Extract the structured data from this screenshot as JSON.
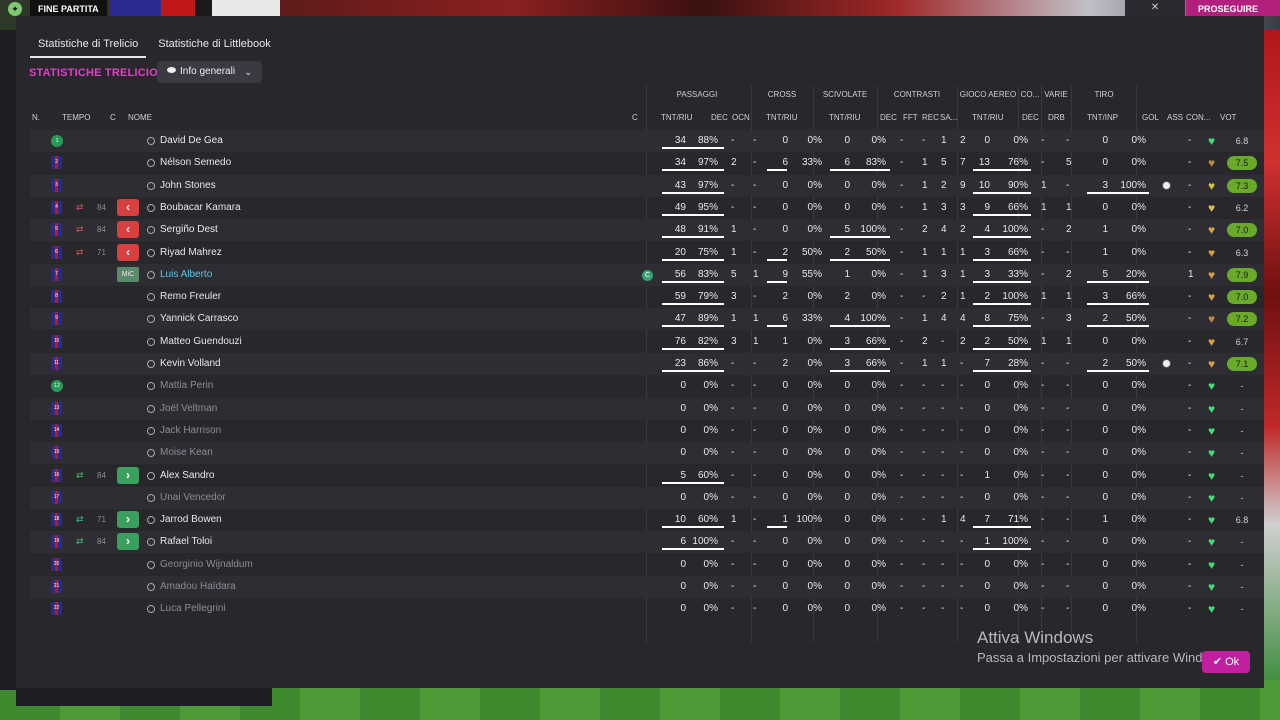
{
  "topbar": {
    "match_label": "FINE PARTITA",
    "continue_label": "PROSEGUIRE"
  },
  "tabs": [
    {
      "label": "Statistiche di Trelicio",
      "active": true
    },
    {
      "label": "Statistiche di Littlebook",
      "active": false
    }
  ],
  "section_title": "STATISTICHE TRELICIO",
  "dropdown": {
    "label": "Info generali"
  },
  "header_groups": {
    "passaggi": "PASSAGGI",
    "cross": "CROSS",
    "scivolate": "SCIVOLATE",
    "contrasti": "CONTRASTI",
    "gioco_aereo": "GIOCO AEREO",
    "co": "CO...",
    "varie": "VARIE",
    "tiro": "TIRO"
  },
  "header_cols": {
    "n": "N.",
    "tempo": "TEMPO",
    "c": "C",
    "nome": "NOME",
    "c2": "C",
    "pass_tnt": "TNT/RIU",
    "dec": "DEC",
    "ocn": "OCN",
    "cross_tnt": "TNT/RIU",
    "sciv_tnt": "TNT/RIU",
    "con_dec": "DEC",
    "fft": "FFT",
    "rec": "REC",
    "sa": "SA...",
    "aereo_tnt": "TNT/RIU",
    "co_dec": "DEC",
    "drb": "DRB",
    "tiro_tnt": "TNT/INP",
    "gol": "GOL",
    "ass": "ASS",
    "con": "CON...",
    "vot": "VOT"
  },
  "players": [
    {
      "n": "1",
      "gk": true,
      "name": "David De Gea",
      "sub": "",
      "min": "",
      "pos": "",
      "cap": false,
      "pass": [
        "34",
        "88%"
      ],
      "dec": "-",
      "ocn": "-",
      "cross": [
        "0",
        "0%"
      ],
      "sciv": [
        "0",
        "0%"
      ],
      "con": [
        "-",
        "-",
        "1",
        "2"
      ],
      "aereo": [
        "0",
        "0%"
      ],
      "codec": "-",
      "drb": "-",
      "tiro": [
        "0",
        "0%"
      ],
      "gol": "",
      "ass": "-",
      "heart": "#40e070",
      "vot": "6.8",
      "vgreen": false,
      "ul": {
        "pass": true,
        "cross": false,
        "sciv": false,
        "aereo": false,
        "tiro": false
      }
    },
    {
      "n": "2",
      "gk": false,
      "name": "Nélson Semedo",
      "sub": "",
      "min": "",
      "pos": "",
      "cap": false,
      "pass": [
        "34",
        "97%"
      ],
      "dec": "2",
      "ocn": "-",
      "cross": [
        "6",
        "33%"
      ],
      "sciv": [
        "6",
        "83%"
      ],
      "con": [
        "-",
        "1",
        "5",
        "7"
      ],
      "aereo": [
        "13",
        "76%"
      ],
      "codec": "-",
      "drb": "5",
      "tiro": [
        "0",
        "0%"
      ],
      "gol": "",
      "ass": "-",
      "heart": "#c08a40",
      "vot": "7.5",
      "vgreen": true,
      "ul": {
        "pass": true,
        "cross": true,
        "sciv": true,
        "aereo": true,
        "tiro": false
      }
    },
    {
      "n": "3",
      "gk": false,
      "name": "John Stones",
      "sub": "",
      "min": "",
      "pos": "",
      "cap": false,
      "pass": [
        "43",
        "97%"
      ],
      "dec": "-",
      "ocn": "-",
      "cross": [
        "0",
        "0%"
      ],
      "sciv": [
        "0",
        "0%"
      ],
      "con": [
        "-",
        "1",
        "2",
        "9"
      ],
      "aereo": [
        "10",
        "90%"
      ],
      "codec": "1",
      "drb": "-",
      "tiro": [
        "3",
        "100%"
      ],
      "gol": "ball",
      "ass": "-",
      "heart": "#d8c040",
      "vot": "7.3",
      "vgreen": true,
      "ul": {
        "pass": true,
        "cross": false,
        "sciv": false,
        "aereo": true,
        "tiro": true
      }
    },
    {
      "n": "4",
      "gk": false,
      "name": "Boubacar Kamara",
      "sub": "out",
      "min": "84",
      "pos": "",
      "cap": false,
      "pass": [
        "49",
        "95%"
      ],
      "dec": "-",
      "ocn": "-",
      "cross": [
        "0",
        "0%"
      ],
      "sciv": [
        "0",
        "0%"
      ],
      "con": [
        "-",
        "1",
        "3",
        "3"
      ],
      "aereo": [
        "9",
        "66%"
      ],
      "codec": "1",
      "drb": "1",
      "tiro": [
        "0",
        "0%"
      ],
      "gol": "",
      "ass": "-",
      "heart": "#d8c040",
      "vot": "6.2",
      "vgreen": false,
      "ul": {
        "pass": true,
        "cross": false,
        "sciv": false,
        "aereo": true,
        "tiro": false
      }
    },
    {
      "n": "5",
      "gk": false,
      "name": "Sergiño Dest",
      "sub": "out",
      "min": "84",
      "pos": "",
      "cap": false,
      "pass": [
        "48",
        "91%"
      ],
      "dec": "1",
      "ocn": "-",
      "cross": [
        "0",
        "0%"
      ],
      "sciv": [
        "5",
        "100%"
      ],
      "con": [
        "-",
        "2",
        "4",
        "2"
      ],
      "aereo": [
        "4",
        "100%"
      ],
      "codec": "-",
      "drb": "2",
      "tiro": [
        "1",
        "0%"
      ],
      "gol": "",
      "ass": "-",
      "heart": "#d8a040",
      "vot": "7.0",
      "vgreen": true,
      "ul": {
        "pass": true,
        "cross": false,
        "sciv": true,
        "aereo": true,
        "tiro": false
      }
    },
    {
      "n": "6",
      "gk": false,
      "name": "Riyad Mahrez",
      "sub": "out",
      "min": "71",
      "pos": "",
      "cap": false,
      "pass": [
        "20",
        "75%"
      ],
      "dec": "1",
      "ocn": "-",
      "cross": [
        "2",
        "50%"
      ],
      "sciv": [
        "2",
        "50%"
      ],
      "con": [
        "-",
        "1",
        "1",
        "1"
      ],
      "aereo": [
        "3",
        "66%"
      ],
      "codec": "-",
      "drb": "-",
      "tiro": [
        "1",
        "0%"
      ],
      "gol": "",
      "ass": "-",
      "heart": "#d8a040",
      "vot": "6.3",
      "vgreen": false,
      "ul": {
        "pass": true,
        "cross": true,
        "sciv": true,
        "aereo": true,
        "tiro": false
      }
    },
    {
      "n": "7",
      "gk": false,
      "name": "Luis Alberto",
      "sub": "",
      "min": "",
      "pos": "MiC",
      "cap": true,
      "pass": [
        "56",
        "83%"
      ],
      "dec": "5",
      "ocn": "1",
      "cross": [
        "9",
        "55%"
      ],
      "sciv": [
        "1",
        "0%"
      ],
      "con": [
        "-",
        "1",
        "3",
        "1"
      ],
      "aereo": [
        "3",
        "33%"
      ],
      "codec": "-",
      "drb": "2",
      "tiro": [
        "5",
        "20%"
      ],
      "gol": "",
      "ass": "1",
      "heart": "#d8a040",
      "vot": "7.9",
      "vgreen": true,
      "ul": {
        "pass": true,
        "cross": true,
        "sciv": false,
        "aereo": true,
        "tiro": true
      }
    },
    {
      "n": "8",
      "gk": false,
      "name": "Remo Freuler",
      "sub": "",
      "min": "",
      "pos": "",
      "cap": false,
      "pass": [
        "59",
        "79%"
      ],
      "dec": "3",
      "ocn": "-",
      "cross": [
        "2",
        "0%"
      ],
      "sciv": [
        "2",
        "0%"
      ],
      "con": [
        "-",
        "-",
        "2",
        "1"
      ],
      "aereo": [
        "2",
        "100%"
      ],
      "codec": "1",
      "drb": "1",
      "tiro": [
        "3",
        "66%"
      ],
      "gol": "",
      "ass": "-",
      "heart": "#d8a040",
      "vot": "7.0",
      "vgreen": true,
      "ul": {
        "pass": true,
        "cross": false,
        "sciv": false,
        "aereo": true,
        "tiro": true
      }
    },
    {
      "n": "9",
      "gk": false,
      "name": "Yannick Carrasco",
      "sub": "",
      "min": "",
      "pos": "",
      "cap": false,
      "pass": [
        "47",
        "89%"
      ],
      "dec": "1",
      "ocn": "1",
      "cross": [
        "6",
        "33%"
      ],
      "sciv": [
        "4",
        "100%"
      ],
      "con": [
        "-",
        "1",
        "4",
        "4"
      ],
      "aereo": [
        "8",
        "75%"
      ],
      "codec": "-",
      "drb": "3",
      "tiro": [
        "2",
        "50%"
      ],
      "gol": "",
      "ass": "-",
      "heart": "#c08a40",
      "vot": "7.2",
      "vgreen": true,
      "ul": {
        "pass": true,
        "cross": true,
        "sciv": true,
        "aereo": true,
        "tiro": true
      }
    },
    {
      "n": "10",
      "gk": false,
      "name": "Matteo Guendouzi",
      "sub": "",
      "min": "",
      "pos": "",
      "cap": false,
      "pass": [
        "76",
        "82%"
      ],
      "dec": "3",
      "ocn": "1",
      "cross": [
        "1",
        "0%"
      ],
      "sciv": [
        "3",
        "66%"
      ],
      "con": [
        "-",
        "2",
        "-",
        "2"
      ],
      "aereo": [
        "2",
        "50%"
      ],
      "codec": "1",
      "drb": "1",
      "tiro": [
        "0",
        "0%"
      ],
      "gol": "",
      "ass": "-",
      "heart": "#d8a040",
      "vot": "6.7",
      "vgreen": false,
      "ul": {
        "pass": true,
        "cross": false,
        "sciv": true,
        "aereo": true,
        "tiro": false
      }
    },
    {
      "n": "11",
      "gk": false,
      "name": "Kevin Volland",
      "sub": "",
      "min": "",
      "pos": "",
      "cap": false,
      "pass": [
        "23",
        "86%"
      ],
      "dec": "-",
      "ocn": "-",
      "cross": [
        "2",
        "0%"
      ],
      "sciv": [
        "3",
        "66%"
      ],
      "con": [
        "-",
        "1",
        "1",
        "-"
      ],
      "aereo": [
        "7",
        "28%"
      ],
      "codec": "-",
      "drb": "-",
      "tiro": [
        "2",
        "50%"
      ],
      "gol": "ball",
      "ass": "-",
      "heart": "#d8a040",
      "vot": "7.1",
      "vgreen": true,
      "ul": {
        "pass": true,
        "cross": false,
        "sciv": true,
        "aereo": true,
        "tiro": true
      }
    },
    {
      "n": "12",
      "gk": true,
      "name": "Mattia Perin",
      "sub": "",
      "min": "",
      "pos": "",
      "cap": false,
      "pass": [
        "0",
        "0%"
      ],
      "dec": "-",
      "ocn": "-",
      "cross": [
        "0",
        "0%"
      ],
      "sciv": [
        "0",
        "0%"
      ],
      "con": [
        "-",
        "-",
        "-",
        "-"
      ],
      "aereo": [
        "0",
        "0%"
      ],
      "codec": "-",
      "drb": "-",
      "tiro": [
        "0",
        "0%"
      ],
      "gol": "",
      "ass": "-",
      "heart": "#40e070",
      "vot": "-",
      "vgreen": false,
      "ul": {
        "pass": false,
        "cross": false,
        "sciv": false,
        "aereo": false,
        "tiro": false
      }
    },
    {
      "n": "13",
      "gk": false,
      "name": "Joël Veltman",
      "sub": "",
      "min": "",
      "pos": "",
      "cap": false,
      "pass": [
        "0",
        "0%"
      ],
      "dec": "-",
      "ocn": "-",
      "cross": [
        "0",
        "0%"
      ],
      "sciv": [
        "0",
        "0%"
      ],
      "con": [
        "-",
        "-",
        "-",
        "-"
      ],
      "aereo": [
        "0",
        "0%"
      ],
      "codec": "-",
      "drb": "-",
      "tiro": [
        "0",
        "0%"
      ],
      "gol": "",
      "ass": "-",
      "heart": "#40e070",
      "vot": "-",
      "vgreen": false,
      "ul": {
        "pass": false,
        "cross": false,
        "sciv": false,
        "aereo": false,
        "tiro": false
      }
    },
    {
      "n": "14",
      "gk": false,
      "name": "Jack Harrison",
      "sub": "",
      "min": "",
      "pos": "",
      "cap": false,
      "pass": [
        "0",
        "0%"
      ],
      "dec": "-",
      "ocn": "-",
      "cross": [
        "0",
        "0%"
      ],
      "sciv": [
        "0",
        "0%"
      ],
      "con": [
        "-",
        "-",
        "-",
        "-"
      ],
      "aereo": [
        "0",
        "0%"
      ],
      "codec": "-",
      "drb": "-",
      "tiro": [
        "0",
        "0%"
      ],
      "gol": "",
      "ass": "-",
      "heart": "#40e070",
      "vot": "-",
      "vgreen": false,
      "ul": {
        "pass": false,
        "cross": false,
        "sciv": false,
        "aereo": false,
        "tiro": false
      }
    },
    {
      "n": "15",
      "gk": false,
      "name": "Moise Kean",
      "sub": "",
      "min": "",
      "pos": "",
      "cap": false,
      "pass": [
        "0",
        "0%"
      ],
      "dec": "-",
      "ocn": "-",
      "cross": [
        "0",
        "0%"
      ],
      "sciv": [
        "0",
        "0%"
      ],
      "con": [
        "-",
        "-",
        "-",
        "-"
      ],
      "aereo": [
        "0",
        "0%"
      ],
      "codec": "-",
      "drb": "-",
      "tiro": [
        "0",
        "0%"
      ],
      "gol": "",
      "ass": "-",
      "heart": "#40e070",
      "vot": "-",
      "vgreen": false,
      "ul": {
        "pass": false,
        "cross": false,
        "sciv": false,
        "aereo": false,
        "tiro": false
      }
    },
    {
      "n": "16",
      "gk": false,
      "name": "Alex Sandro",
      "sub": "in",
      "min": "84",
      "pos": "",
      "cap": false,
      "pass": [
        "5",
        "60%"
      ],
      "dec": "-",
      "ocn": "-",
      "cross": [
        "0",
        "0%"
      ],
      "sciv": [
        "0",
        "0%"
      ],
      "con": [
        "-",
        "-",
        "-",
        "-"
      ],
      "aereo": [
        "1",
        "0%"
      ],
      "codec": "-",
      "drb": "-",
      "tiro": [
        "0",
        "0%"
      ],
      "gol": "",
      "ass": "-",
      "heart": "#40e070",
      "vot": "-",
      "vgreen": false,
      "ul": {
        "pass": true,
        "cross": false,
        "sciv": false,
        "aereo": false,
        "tiro": false
      }
    },
    {
      "n": "17",
      "gk": false,
      "name": "Unai Vencedor",
      "sub": "",
      "min": "",
      "pos": "",
      "cap": false,
      "pass": [
        "0",
        "0%"
      ],
      "dec": "-",
      "ocn": "-",
      "cross": [
        "0",
        "0%"
      ],
      "sciv": [
        "0",
        "0%"
      ],
      "con": [
        "-",
        "-",
        "-",
        "-"
      ],
      "aereo": [
        "0",
        "0%"
      ],
      "codec": "-",
      "drb": "-",
      "tiro": [
        "0",
        "0%"
      ],
      "gol": "",
      "ass": "-",
      "heart": "#40e070",
      "vot": "-",
      "vgreen": false,
      "ul": {
        "pass": false,
        "cross": false,
        "sciv": false,
        "aereo": false,
        "tiro": false
      }
    },
    {
      "n": "18",
      "gk": false,
      "name": "Jarrod Bowen",
      "sub": "in",
      "min": "71",
      "pos": "",
      "cap": false,
      "pass": [
        "10",
        "60%"
      ],
      "dec": "1",
      "ocn": "-",
      "cross": [
        "1",
        "100%"
      ],
      "sciv": [
        "0",
        "0%"
      ],
      "con": [
        "-",
        "-",
        "1",
        "4"
      ],
      "aereo": [
        "7",
        "71%"
      ],
      "codec": "-",
      "drb": "-",
      "tiro": [
        "1",
        "0%"
      ],
      "gol": "",
      "ass": "-",
      "heart": "#40e070",
      "vot": "6.8",
      "vgreen": false,
      "ul": {
        "pass": true,
        "cross": true,
        "sciv": false,
        "aereo": true,
        "tiro": false
      }
    },
    {
      "n": "19",
      "gk": false,
      "name": "Rafael Toloi",
      "sub": "in",
      "min": "84",
      "pos": "",
      "cap": false,
      "pass": [
        "6",
        "100%"
      ],
      "dec": "-",
      "ocn": "-",
      "cross": [
        "0",
        "0%"
      ],
      "sciv": [
        "0",
        "0%"
      ],
      "con": [
        "-",
        "-",
        "-",
        "-"
      ],
      "aereo": [
        "1",
        "100%"
      ],
      "codec": "-",
      "drb": "-",
      "tiro": [
        "0",
        "0%"
      ],
      "gol": "",
      "ass": "-",
      "heart": "#40e070",
      "vot": "-",
      "vgreen": false,
      "ul": {
        "pass": true,
        "cross": false,
        "sciv": false,
        "aereo": true,
        "tiro": false
      }
    },
    {
      "n": "20",
      "gk": false,
      "name": "Georginio Wijnaldum",
      "sub": "",
      "min": "",
      "pos": "",
      "cap": false,
      "pass": [
        "0",
        "0%"
      ],
      "dec": "-",
      "ocn": "-",
      "cross": [
        "0",
        "0%"
      ],
      "sciv": [
        "0",
        "0%"
      ],
      "con": [
        "-",
        "-",
        "-",
        "-"
      ],
      "aereo": [
        "0",
        "0%"
      ],
      "codec": "-",
      "drb": "-",
      "tiro": [
        "0",
        "0%"
      ],
      "gol": "",
      "ass": "-",
      "heart": "#40e070",
      "vot": "-",
      "vgreen": false,
      "ul": {
        "pass": false,
        "cross": false,
        "sciv": false,
        "aereo": false,
        "tiro": false
      }
    },
    {
      "n": "21",
      "gk": false,
      "name": "Amadou Haïdara",
      "sub": "",
      "min": "",
      "pos": "",
      "cap": false,
      "pass": [
        "0",
        "0%"
      ],
      "dec": "-",
      "ocn": "-",
      "cross": [
        "0",
        "0%"
      ],
      "sciv": [
        "0",
        "0%"
      ],
      "con": [
        "-",
        "-",
        "-",
        "-"
      ],
      "aereo": [
        "0",
        "0%"
      ],
      "codec": "-",
      "drb": "-",
      "tiro": [
        "0",
        "0%"
      ],
      "gol": "",
      "ass": "-",
      "heart": "#40e070",
      "vot": "-",
      "vgreen": false,
      "ul": {
        "pass": false,
        "cross": false,
        "sciv": false,
        "aereo": false,
        "tiro": false
      }
    },
    {
      "n": "22",
      "gk": false,
      "name": "Luca Pellegrini",
      "sub": "",
      "min": "",
      "pos": "",
      "cap": false,
      "pass": [
        "0",
        "0%"
      ],
      "dec": "-",
      "ocn": "-",
      "cross": [
        "0",
        "0%"
      ],
      "sciv": [
        "0",
        "0%"
      ],
      "con": [
        "-",
        "-",
        "-",
        "-"
      ],
      "aereo": [
        "0",
        "0%"
      ],
      "codec": "-",
      "drb": "-",
      "tiro": [
        "0",
        "0%"
      ],
      "gol": "",
      "ass": "-",
      "heart": "#40e070",
      "vot": "-",
      "vgreen": false,
      "ul": {
        "pass": false,
        "cross": false,
        "sciv": false,
        "aereo": false,
        "tiro": false
      }
    }
  ],
  "watermark": {
    "title": "Attiva Windows",
    "subtitle": "Passa a Impostazioni per attivare Windows."
  },
  "ok_button": {
    "label": "Ok"
  },
  "colors": {
    "accent": "#e040c8",
    "ok": "#c020a0",
    "vote_green": "#6aaa2a"
  }
}
